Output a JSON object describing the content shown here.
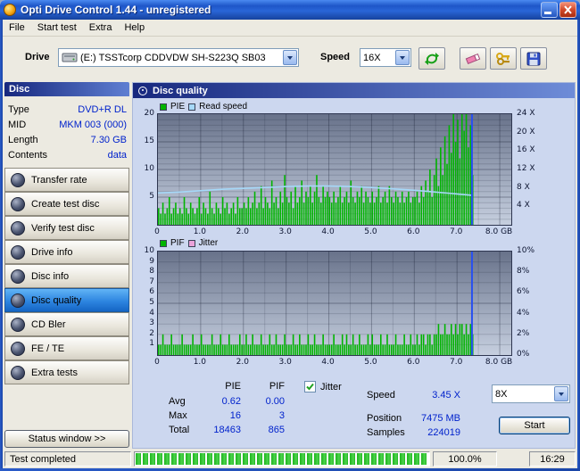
{
  "window": {
    "title": "Opti Drive Control 1.44  -  unregistered"
  },
  "menu": {
    "items": [
      "File",
      "Start test",
      "Extra",
      "Help"
    ]
  },
  "toolbar": {
    "drive_label": "Drive",
    "drive_value": "(E:)  TSSTcorp CDDVDW SH-S223Q SB03",
    "speed_label": "Speed",
    "speed_value": "16X",
    "icons": [
      "drive-icon",
      "refresh-icon",
      "eraser-icon",
      "keys-icon",
      "save-icon"
    ]
  },
  "sidebar": {
    "disc_header": "Disc",
    "info": [
      {
        "label": "Type",
        "value": "DVD+R DL"
      },
      {
        "label": "MID",
        "value": "MKM 003 (000)"
      },
      {
        "label": "Length",
        "value": "7.30 GB"
      },
      {
        "label": "Contents",
        "value": "data"
      }
    ],
    "buttons": [
      "Transfer rate",
      "Create test disc",
      "Verify test disc",
      "Drive info",
      "Disc info",
      "Disc quality",
      "CD Bler",
      "FE / TE",
      "Extra tests"
    ],
    "selected_button": "Disc quality",
    "status_button": "Status window >>"
  },
  "main": {
    "header": "Disc quality"
  },
  "results": {
    "pie_header": "PIE",
    "pif_header": "PIF",
    "jitter_label": "Jitter",
    "jitter_checked": true,
    "rows": [
      {
        "label": "Avg",
        "pie": "0.62",
        "pif": "0.00"
      },
      {
        "label": "Max",
        "pie": "16",
        "pif": "3"
      },
      {
        "label": "Total",
        "pie": "18463",
        "pif": "865"
      }
    ],
    "speed_label": "Speed",
    "speed_value": "3.45 X",
    "speed_select_value": "8X",
    "position_label": "Position",
    "position_value": "7475 MB",
    "samples_label": "Samples",
    "samples_value": "224019",
    "start_label": "Start"
  },
  "statusbar": {
    "status": "Test completed",
    "percent": "100.0%",
    "time": "16:29",
    "progress": 100
  },
  "chart_data": [
    {
      "type": "bar",
      "title": "PIE and Read speed vs disc position",
      "legend": [
        {
          "label": "PIE",
          "color": "#00b400"
        },
        {
          "label": "Read speed",
          "color": "#a6d8f8"
        }
      ],
      "xlim": [
        0,
        8.27
      ],
      "x_ticks": [
        {
          "v": 0,
          "label": "0"
        },
        {
          "v": 1,
          "label": "1.0"
        },
        {
          "v": 2,
          "label": "2.0"
        },
        {
          "v": 3,
          "label": "3.0"
        },
        {
          "v": 4,
          "label": "4.0"
        },
        {
          "v": 5,
          "label": "5.0"
        },
        {
          "v": 6,
          "label": "6.0"
        },
        {
          "v": 7,
          "label": "7.0"
        },
        {
          "v": 8,
          "label": "8.0 GB"
        }
      ],
      "ylim_left": [
        0,
        20
      ],
      "left_ticks": [
        {
          "v": 5,
          "label": "5"
        },
        {
          "v": 10,
          "label": "10"
        },
        {
          "v": 15,
          "label": "15"
        },
        {
          "v": 20,
          "label": "20"
        }
      ],
      "ylim_right": [
        0,
        24
      ],
      "right_ticks": [
        {
          "v": 24,
          "label": "24 X"
        },
        {
          "v": 20,
          "label": "20 X"
        },
        {
          "v": 16,
          "label": "16 X"
        },
        {
          "v": 12,
          "label": "12 X"
        },
        {
          "v": 8,
          "label": "8 X"
        },
        {
          "v": 4,
          "label": "4 X"
        }
      ],
      "bar_step_gb": 0.05,
      "bar_color": "#00b400",
      "values": [
        3,
        2,
        4,
        2,
        3,
        5,
        2,
        3,
        4,
        2,
        3,
        2,
        5,
        3,
        2,
        4,
        3,
        2,
        3,
        5,
        2,
        4,
        3,
        2,
        6,
        3,
        2,
        4,
        3,
        2,
        5,
        3,
        4,
        2,
        3,
        4,
        2,
        5,
        3,
        3,
        4,
        3,
        5,
        3,
        4,
        6,
        3,
        4,
        7,
        3,
        5,
        4,
        3,
        8,
        4,
        5,
        3,
        6,
        4,
        9,
        5,
        4,
        6,
        3,
        7,
        4,
        5,
        8,
        4,
        6,
        5,
        7,
        4,
        6,
        9,
        5,
        4,
        7,
        5,
        6,
        5,
        4,
        6,
        4,
        5,
        7,
        4,
        5,
        6,
        4,
        8,
        5,
        4,
        6,
        5,
        7,
        4,
        6,
        5,
        4,
        6,
        4,
        5,
        7,
        4,
        5,
        6,
        4,
        7,
        5,
        4,
        6,
        5,
        4,
        6,
        4,
        5,
        6,
        4,
        5,
        5,
        6,
        4,
        7,
        5,
        8,
        6,
        10,
        5,
        9,
        12,
        7,
        14,
        9,
        16,
        11,
        18,
        13,
        20,
        15,
        19,
        12,
        20,
        17,
        20,
        14,
        18,
        9
      ],
      "read_speed": {
        "color": "#a6d8f8",
        "points": [
          {
            "x": 0,
            "speed": 6.9
          },
          {
            "x": 0.5,
            "speed": 7.1
          },
          {
            "x": 1,
            "speed": 7.4
          },
          {
            "x": 1.5,
            "speed": 7.7
          },
          {
            "x": 2,
            "speed": 7.9
          },
          {
            "x": 2.5,
            "speed": 8.1
          },
          {
            "x": 3,
            "speed": 8.3
          },
          {
            "x": 3.5,
            "speed": 8.4
          },
          {
            "x": 4,
            "speed": 8.4
          },
          {
            "x": 4.5,
            "speed": 8.3
          },
          {
            "x": 5,
            "speed": 8.1
          },
          {
            "x": 5.5,
            "speed": 7.8
          },
          {
            "x": 6,
            "speed": 7.5
          },
          {
            "x": 6.5,
            "speed": 7.1
          },
          {
            "x": 7,
            "speed": 6.7
          },
          {
            "x": 7.35,
            "speed": 6.4
          }
        ]
      },
      "position_line_gb": 7.35,
      "position_line_color": "#2850f0"
    },
    {
      "type": "bar",
      "title": "PIF and Jitter vs disc position",
      "legend": [
        {
          "label": "PIF",
          "color": "#00b400"
        },
        {
          "label": "Jitter",
          "color": "#eaa2da"
        }
      ],
      "xlim": [
        0,
        8.27
      ],
      "x_ticks": [
        {
          "v": 0,
          "label": "0"
        },
        {
          "v": 1,
          "label": "1.0"
        },
        {
          "v": 2,
          "label": "2.0"
        },
        {
          "v": 3,
          "label": "3.0"
        },
        {
          "v": 4,
          "label": "4.0"
        },
        {
          "v": 5,
          "label": "5.0"
        },
        {
          "v": 6,
          "label": "6.0"
        },
        {
          "v": 7,
          "label": "7.0"
        },
        {
          "v": 8,
          "label": "8.0 GB"
        }
      ],
      "ylim_left": [
        0,
        10
      ],
      "left_ticks": [
        {
          "v": 1,
          "label": "1"
        },
        {
          "v": 2,
          "label": "2"
        },
        {
          "v": 3,
          "label": "3"
        },
        {
          "v": 4,
          "label": "4"
        },
        {
          "v": 5,
          "label": "5"
        },
        {
          "v": 6,
          "label": "6"
        },
        {
          "v": 7,
          "label": "7"
        },
        {
          "v": 8,
          "label": "8"
        },
        {
          "v": 9,
          "label": "9"
        },
        {
          "v": 10,
          "label": "10"
        }
      ],
      "ylim_right": [
        0,
        10
      ],
      "right_ticks": [
        {
          "v": 10,
          "label": "10%"
        },
        {
          "v": 8,
          "label": "8%"
        },
        {
          "v": 6,
          "label": "6%"
        },
        {
          "v": 4,
          "label": "4%"
        },
        {
          "v": 2,
          "label": "2%"
        },
        {
          "v": 0,
          "label": "0%"
        }
      ],
      "bar_step_gb": 0.05,
      "bar_color": "#00b400",
      "values": [
        1,
        1,
        2,
        1,
        1,
        1,
        2,
        1,
        1,
        1,
        1,
        2,
        1,
        1,
        1,
        1,
        2,
        1,
        1,
        1,
        2,
        1,
        1,
        1,
        1,
        2,
        1,
        1,
        1,
        2,
        1,
        1,
        1,
        2,
        1,
        1,
        1,
        1,
        2,
        1,
        1,
        2,
        1,
        1,
        2,
        1,
        1,
        1,
        2,
        1,
        1,
        1,
        2,
        1,
        1,
        2,
        1,
        1,
        1,
        2,
        1,
        1,
        1,
        2,
        1,
        1,
        2,
        1,
        1,
        1,
        2,
        1,
        1,
        2,
        1,
        1,
        1,
        2,
        1,
        1,
        1,
        1,
        2,
        1,
        1,
        1,
        2,
        1,
        2,
        1,
        1,
        2,
        1,
        1,
        2,
        1,
        1,
        1,
        2,
        1,
        2,
        1,
        1,
        1,
        2,
        1,
        1,
        2,
        1,
        1,
        1,
        2,
        1,
        1,
        1,
        2,
        1,
        1,
        2,
        1,
        1,
        2,
        1,
        2,
        2,
        1,
        2,
        2,
        1,
        2,
        2,
        3,
        2,
        2,
        3,
        2,
        2,
        3,
        2,
        3,
        2,
        3,
        3,
        2,
        3,
        2,
        3,
        2
      ],
      "position_line_gb": 7.35,
      "position_line_color": "#2850f0"
    }
  ]
}
